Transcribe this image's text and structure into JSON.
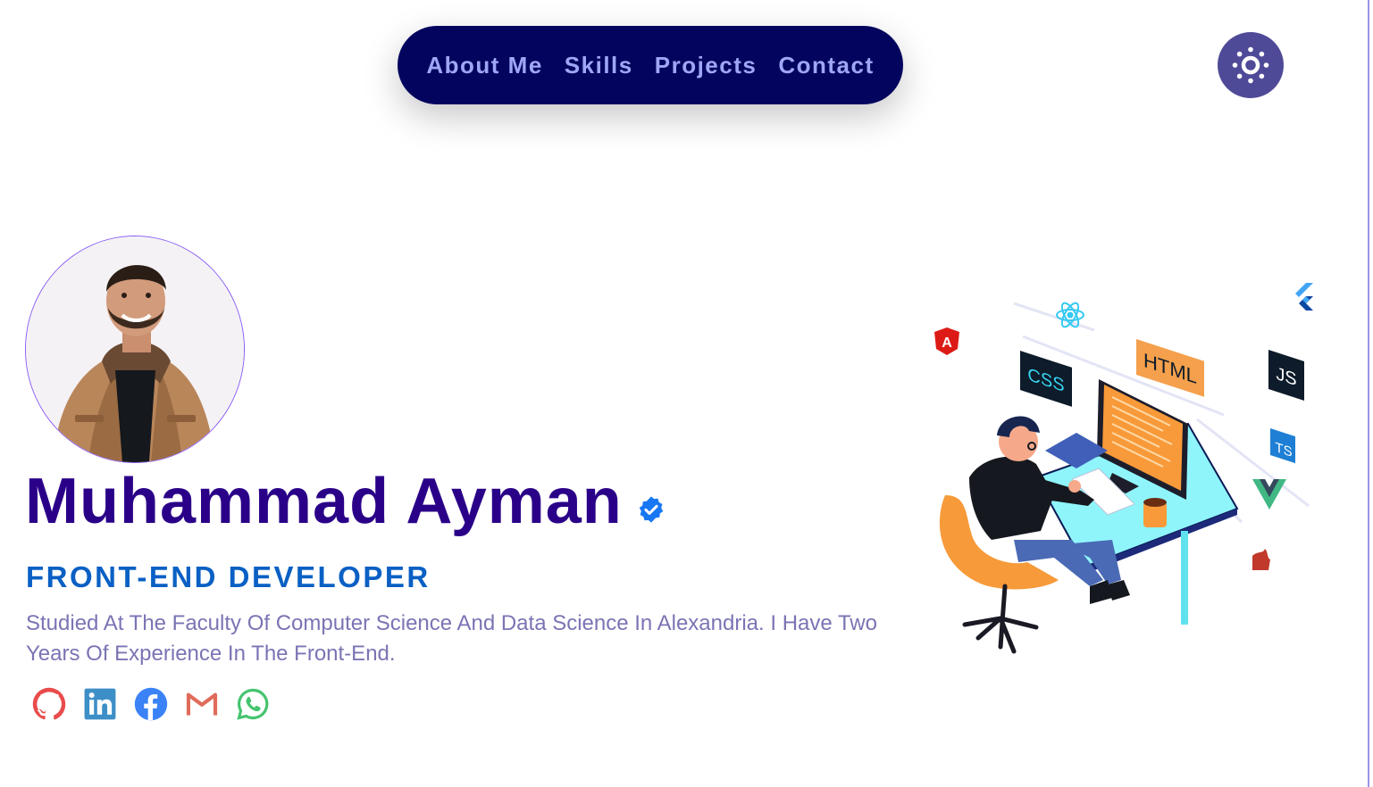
{
  "nav": {
    "items": [
      {
        "label": "About Me"
      },
      {
        "label": "Skills"
      },
      {
        "label": "Projects"
      },
      {
        "label": "Contact"
      }
    ]
  },
  "theme_toggle": {
    "icon": "sun-icon"
  },
  "profile": {
    "name": "Muhammad Ayman",
    "verified_icon": "verified-badge-icon",
    "role": "FRONT-END DEVELOPER",
    "bio": "Studied At The Faculty Of Computer Science And Data Science In Alexandria. I Have Two Years Of Experience In The Front-End."
  },
  "socials": [
    {
      "icon": "github-icon",
      "color": "#e94b4b"
    },
    {
      "icon": "linkedin-icon",
      "color": "#3d8fc7"
    },
    {
      "icon": "facebook-icon",
      "color": "#3b82f6"
    },
    {
      "icon": "gmail-icon",
      "color": "#e06b5a"
    },
    {
      "icon": "whatsapp-icon",
      "color": "#45c46e"
    }
  ],
  "illustration": {
    "badges": [
      "CSS",
      "HTML",
      "JS",
      "TS"
    ]
  },
  "colors": {
    "nav_bg": "#03045e",
    "nav_text": "#9fa6f5",
    "name": "#2a0088",
    "role": "#0a60c4",
    "bio": "#7a74b4",
    "toggle_bg": "#4f4a97"
  }
}
